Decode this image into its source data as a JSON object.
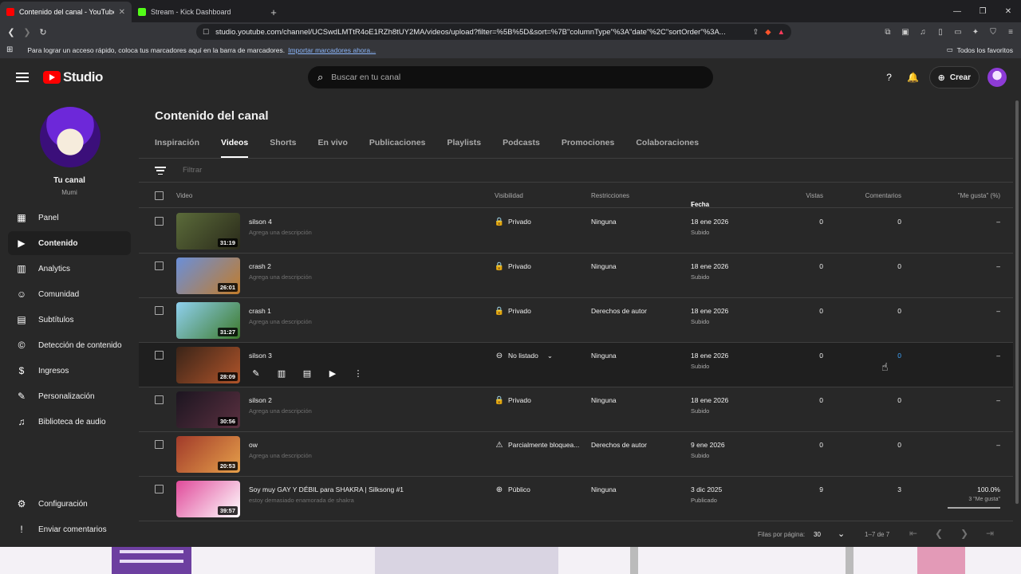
{
  "browser": {
    "tabs": [
      {
        "title": "Contenido del canal - YouTube Studio",
        "favicon_color": "#ff0000",
        "active": true
      },
      {
        "title": "Stream - Kick Dashboard",
        "favicon_color": "#53fc18",
        "active": false
      }
    ],
    "url": "studio.youtube.com/channel/UCSwdLMTtR4oE1RZh8tUY2MA/videos/upload?filter=%5B%5D&sort=%7B\"columnType\"%3A\"date\"%2C\"sortOrder\"%3A...",
    "bookmarks_text": "Para lograr un acceso rápido, coloca tus marcadores aquí en la barra de marcadores.",
    "bookmarks_link": "Importar marcadores ahora...",
    "favorites_label": "Todos los favoritos"
  },
  "header": {
    "logo_text": "Studio",
    "search_placeholder": "Buscar en tu canal",
    "create_label": "Crear"
  },
  "sidebar": {
    "channel_name": "Tu canal",
    "channel_sub": "Mumi",
    "items": [
      {
        "label": "Panel",
        "icon": "dashboard-icon",
        "glyph": "▦"
      },
      {
        "label": "Contenido",
        "icon": "content-icon",
        "glyph": "▶",
        "active": true
      },
      {
        "label": "Analytics",
        "icon": "analytics-icon",
        "glyph": "▥"
      },
      {
        "label": "Comunidad",
        "icon": "community-icon",
        "glyph": "☺"
      },
      {
        "label": "Subtítulos",
        "icon": "subtitles-icon",
        "glyph": "▤"
      },
      {
        "label": "Detección de contenido",
        "icon": "copyright-icon",
        "glyph": "©"
      },
      {
        "label": "Ingresos",
        "icon": "earn-icon",
        "glyph": "$"
      },
      {
        "label": "Personalización",
        "icon": "customization-icon",
        "glyph": "✎"
      },
      {
        "label": "Biblioteca de audio",
        "icon": "audio-library-icon",
        "glyph": "♫"
      }
    ],
    "bottom_items": [
      {
        "label": "Configuración",
        "icon": "settings-icon",
        "glyph": "⚙"
      },
      {
        "label": "Enviar comentarios",
        "icon": "feedback-icon",
        "glyph": "!"
      }
    ]
  },
  "main": {
    "title": "Contenido del canal",
    "tabs": [
      "Inspiración",
      "Videos",
      "Shorts",
      "En vivo",
      "Publicaciones",
      "Playlists",
      "Podcasts",
      "Promociones",
      "Colaboraciones"
    ],
    "active_tab": "Videos",
    "filter_placeholder": "Filtrar",
    "columns": {
      "video": "Video",
      "visibility": "Visibilidad",
      "restrictions": "Restricciones",
      "date": "Fecha",
      "views": "Vistas",
      "comments": "Comentarios",
      "likes": "\"Me gusta\" (%)"
    },
    "rows": [
      {
        "title": "silson 4",
        "desc": "Agrega una descripción",
        "duration": "31:19",
        "visibility": "Privado",
        "vis_icon": "lock-icon",
        "restrictions": "Ninguna",
        "date": "18 ene 2026",
        "status": "Subido",
        "views": "0",
        "comments": "0",
        "likes": "–",
        "thumb": [
          "#5b6b3a",
          "#2a2a1a"
        ]
      },
      {
        "title": "crash 2",
        "desc": "Agrega una descripción",
        "duration": "26:01",
        "visibility": "Privado",
        "vis_icon": "lock-icon",
        "restrictions": "Ninguna",
        "date": "18 ene 2026",
        "status": "Subido",
        "views": "0",
        "comments": "0",
        "likes": "–",
        "thumb": [
          "#6a8fd9",
          "#c27c2a"
        ]
      },
      {
        "title": "crash 1",
        "desc": "Agrega una descripción",
        "duration": "31:27",
        "visibility": "Privado",
        "vis_icon": "lock-icon",
        "restrictions": "Derechos de autor",
        "date": "18 ene 2026",
        "status": "Subido",
        "views": "0",
        "comments": "0",
        "likes": "–",
        "thumb": [
          "#8fd0ef",
          "#3d7a2b"
        ]
      },
      {
        "title": "silson 3",
        "desc": "",
        "duration": "28:09",
        "visibility": "No listado",
        "vis_icon": "link-icon",
        "restrictions": "Ninguna",
        "date": "18 ene 2026",
        "status": "Subido",
        "views": "0",
        "comments": "0",
        "likes": "–",
        "thumb": [
          "#3a2418",
          "#b0542a"
        ],
        "hover": true
      },
      {
        "title": "silson 2",
        "desc": "Agrega una descripción",
        "duration": "30:56",
        "visibility": "Privado",
        "vis_icon": "lock-icon",
        "restrictions": "Ninguna",
        "date": "18 ene 2026",
        "status": "Subido",
        "views": "0",
        "comments": "0",
        "likes": "–",
        "thumb": [
          "#1c1520",
          "#5a3040"
        ]
      },
      {
        "title": "ow",
        "desc": "Agrega una descripción",
        "duration": "20:53",
        "visibility": "Parcialmente bloquea...",
        "vis_icon": "warning-icon",
        "restrictions": "Derechos de autor",
        "date": "9 ene 2026",
        "status": "Subido",
        "views": "0",
        "comments": "0",
        "likes": "–",
        "thumb": [
          "#a13a2a",
          "#e6a04a"
        ]
      },
      {
        "title": "Soy muy GAY Y DÉBIL para SHAKRA | Silksong #1",
        "desc": "estoy demasiado enamorada de shakra",
        "duration": "39:57",
        "visibility": "Público",
        "vis_icon": "globe-icon",
        "restrictions": "Ninguna",
        "date": "3 dic 2025",
        "status": "Publicado",
        "views": "9",
        "comments": "3",
        "likes": "100.0%",
        "likes_sub": "3 \"Me gusta\"",
        "likes_fraction": 1.0,
        "thumb": [
          "#e04a9a",
          "#ffffff"
        ]
      }
    ],
    "footer": {
      "per_page_label": "Filas por página:",
      "per_page_value": "30",
      "range": "1–7 de 7"
    }
  },
  "colors": {
    "accent_red": "#ff0000",
    "link_blue": "#3ea6ff",
    "bg": "#282828"
  }
}
